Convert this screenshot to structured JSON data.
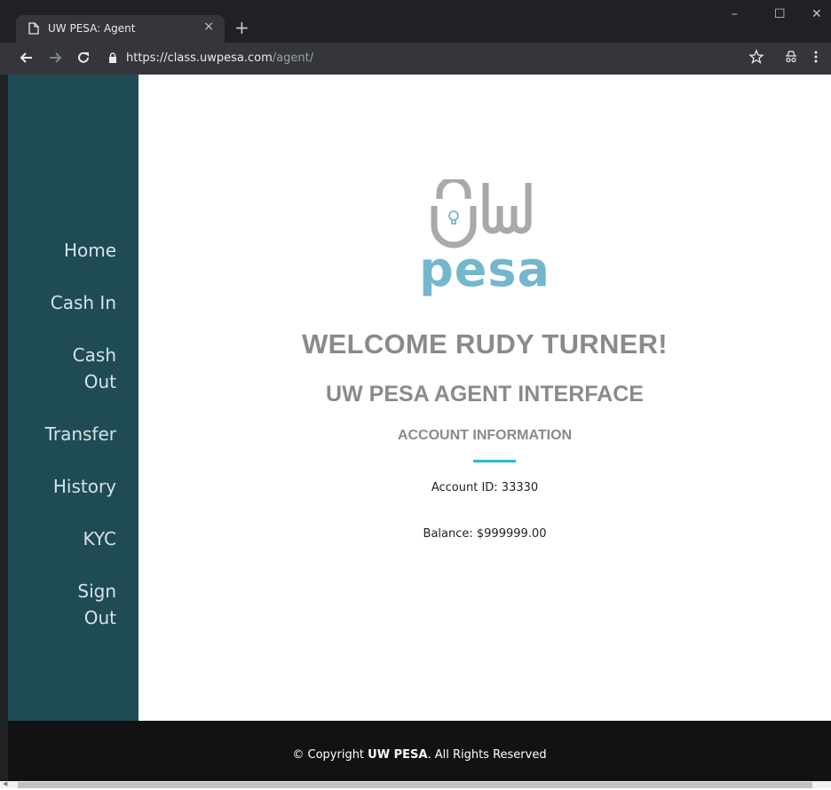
{
  "browser": {
    "tab_title": "UW PESA: Agent",
    "tab_close": "×",
    "new_tab": "+",
    "url_host": "https://class.uwpesa.com",
    "url_path": "/agent/",
    "window_controls": {
      "minimize": "–",
      "maximize": "☐",
      "close": "✕"
    }
  },
  "sidebar": {
    "items": [
      {
        "label": "Home"
      },
      {
        "label": "Cash In"
      },
      {
        "label": "Cash Out"
      },
      {
        "label": "Transfer"
      },
      {
        "label": "History"
      },
      {
        "label": "KYC"
      },
      {
        "label": "Sign Out"
      }
    ]
  },
  "main": {
    "logo_text": "pesa",
    "welcome": "WELCOME RUDY TURNER!",
    "subtitle": "UW PESA AGENT INTERFACE",
    "account_section_title": "ACCOUNT INFORMATION",
    "account_id_line": "Account ID: 33330",
    "balance_line": "Balance: $999999.00"
  },
  "footer": {
    "prefix": "© Copyright ",
    "brand": "UW PESA",
    "suffix": ". All Rights Reserved"
  },
  "colors": {
    "sidebar_bg": "#1f4b55",
    "accent": "#27b8d8",
    "logo_gray": "#a9a9a9",
    "logo_blue": "#74b7cc",
    "footer_bg": "#121212"
  }
}
